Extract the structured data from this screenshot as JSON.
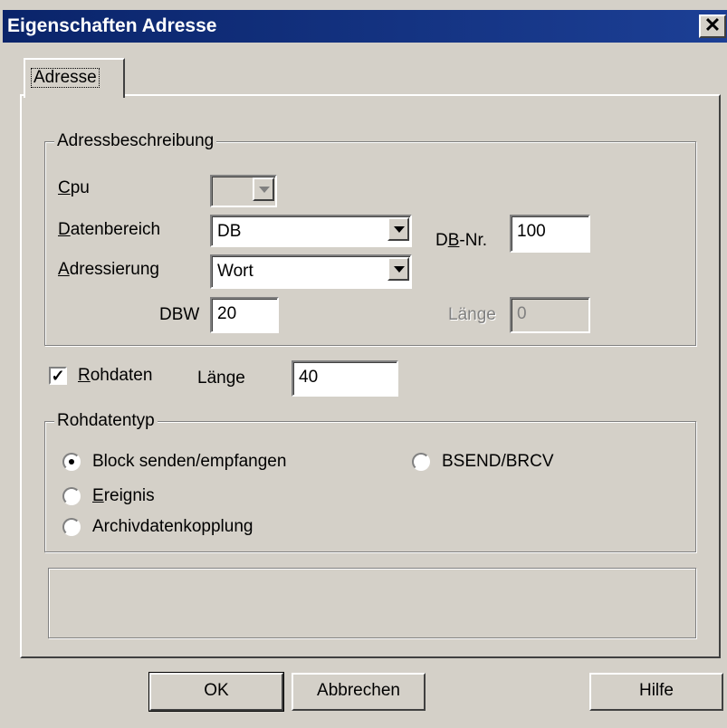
{
  "window": {
    "title": "Eigenschaften Adresse",
    "close_glyph": "✕"
  },
  "tabs": [
    {
      "label": "Adresse",
      "selected": true
    }
  ],
  "address_group": {
    "legend": "Adressbeschreibung",
    "cpu": {
      "label": "Cpu",
      "mnemonic": "C",
      "rest": "pu",
      "value": "",
      "enabled": false
    },
    "data_area": {
      "label": "Datenbereich",
      "mnemonic": "D",
      "rest": "atenbereich",
      "value": "DB"
    },
    "db_nr": {
      "label": "DB-Nr.",
      "pre": "D",
      "mnemonic": "B",
      "rest": "-Nr.",
      "value": "100"
    },
    "addressing": {
      "label": "Adressierung",
      "mnemonic": "A",
      "rest": "dressierung",
      "value": "Wort"
    },
    "dbw": {
      "label": "DBW",
      "value": "20"
    },
    "length": {
      "label": "Länge",
      "value": "0",
      "enabled": false
    }
  },
  "raw_data": {
    "checkbox": {
      "label": "Rohdaten",
      "mnemonic": "R",
      "rest": "ohdaten",
      "checked": true,
      "glyph": "✓"
    },
    "length": {
      "label": "Länge",
      "value": "40"
    }
  },
  "raw_type_group": {
    "legend": "Rohdatentyp",
    "options": [
      {
        "label": "Block senden/empfangen",
        "selected": true
      },
      {
        "label": "BSEND/BRCV",
        "selected": false
      },
      {
        "label": "Ereignis",
        "mnemonic": "E",
        "rest": "reignis",
        "selected": false
      },
      {
        "label": "Archivdatenkopplung",
        "selected": false
      }
    ]
  },
  "status_text": "",
  "buttons": {
    "ok": "OK",
    "cancel": "Abbrechen",
    "help": "Hilfe"
  }
}
